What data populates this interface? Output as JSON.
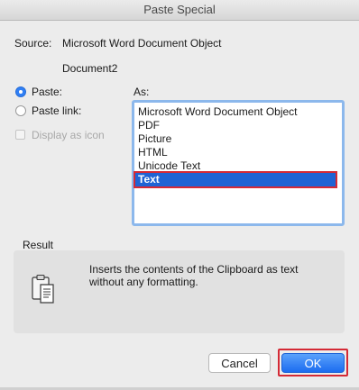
{
  "window": {
    "title": "Paste Special"
  },
  "source": {
    "label": "Source:",
    "value": "Microsoft Word Document Object",
    "document": "Document2"
  },
  "options": {
    "paste_label": "Paste:",
    "paste_link_label": "Paste link:",
    "display_as_icon_label": "Display as icon",
    "selected": "paste"
  },
  "as_list": {
    "label": "As:",
    "items": [
      "Microsoft Word Document Object",
      "PDF",
      "Picture",
      "HTML",
      "Unicode Text",
      "Text"
    ],
    "selected_index": 5
  },
  "result": {
    "label": "Result",
    "line1": "Inserts the contents of the Clipboard as text",
    "line2": "without any formatting.",
    "icon": "clipboard-icon"
  },
  "buttons": {
    "cancel_label": "Cancel",
    "ok_label": "OK"
  },
  "colors": {
    "accent": "#1f63d4",
    "highlight": "#d42a36",
    "list_border": "#8cb8ec"
  }
}
